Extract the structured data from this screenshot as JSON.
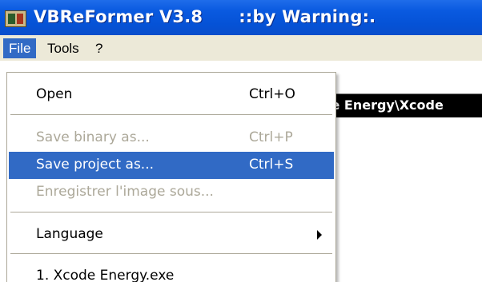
{
  "window": {
    "title": "VBReFormer V3.8      ::by Warning:.",
    "icon": "app-icon"
  },
  "menubar": {
    "items": [
      {
        "label": "File",
        "active": true
      },
      {
        "label": "Tools",
        "active": false
      },
      {
        "label": "?",
        "active": false
      }
    ]
  },
  "background": {
    "path_text": "le Energy\\Xcode"
  },
  "file_menu": {
    "items": [
      {
        "label": "Open",
        "shortcut": "Ctrl+O",
        "state": "enabled"
      },
      {
        "label": "Save binary as...",
        "shortcut": "Ctrl+P",
        "state": "disabled"
      },
      {
        "label": "Save project as...",
        "shortcut": "Ctrl+S",
        "state": "highlighted"
      },
      {
        "label": "Enregistrer l'image sous...",
        "shortcut": "",
        "state": "disabled"
      },
      {
        "label": "Language",
        "shortcut": "",
        "state": "enabled",
        "submenu": true
      },
      {
        "label": "1. Xcode Energy.exe",
        "shortcut": "",
        "state": "enabled"
      }
    ]
  },
  "colors": {
    "titlebar": "#0a5ae0",
    "highlight": "#316ac5",
    "menubar": "#ece9d8",
    "disabled_text": "#aca899"
  }
}
